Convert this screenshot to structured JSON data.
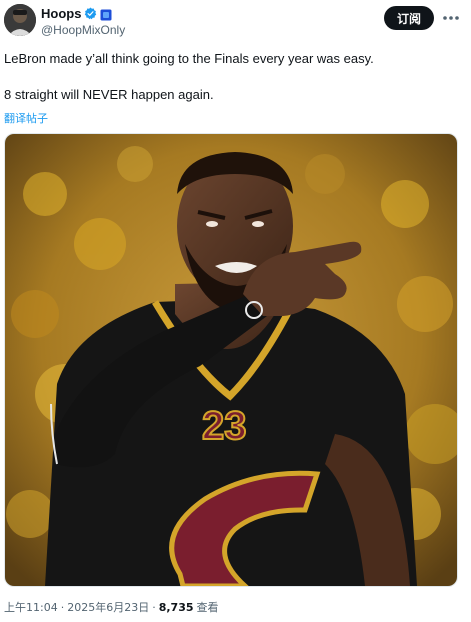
{
  "account": {
    "display_name": "Hoops",
    "handle": "@HoopMixOnly"
  },
  "header": {
    "subscribe_label": "订阅"
  },
  "post": {
    "line1": "LeBron made y’all think going to the Finals every year was easy.",
    "line2": "8 straight will NEVER happen again.",
    "translate_label": "翻译帖子",
    "jersey_number": "23"
  },
  "meta": {
    "time": "上午11:04",
    "separator1": "·",
    "date": "2025年6月23日",
    "separator2": "·",
    "views_count": "8,735",
    "views_label": "查看"
  },
  "colors": {
    "verified": "#1d9bf0",
    "link": "#1d9bf0",
    "subscribe_bg": "#0f1419",
    "jersey": "#151515",
    "jersey_trim": "#d4a52a",
    "logo_wine": "#7a1e2e",
    "crowd_yellow": "#e0b32c"
  },
  "icons": {
    "verified": "verified-badge-icon",
    "affiliation": "affiliation-badge-icon",
    "more": "more-options-icon"
  }
}
